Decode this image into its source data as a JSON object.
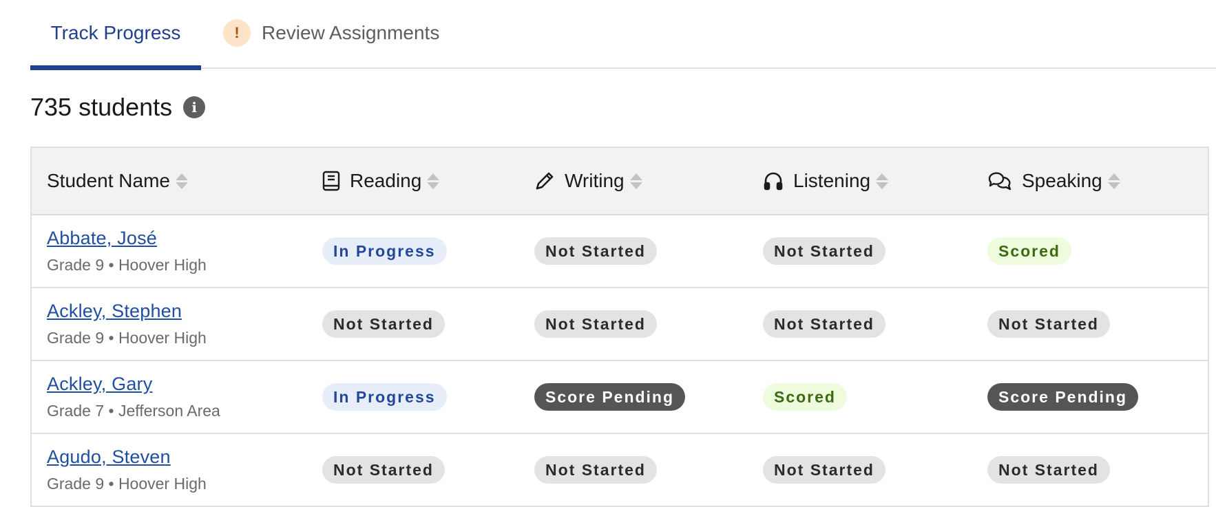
{
  "tabs": [
    {
      "label": "Track Progress",
      "active": true
    },
    {
      "label": "Review Assignments",
      "alert_icon": "exclamation-icon",
      "alert_glyph": "!"
    }
  ],
  "count": {
    "text": "735 students",
    "info_icon": "info-icon",
    "info_glyph": "i"
  },
  "table": {
    "headers": [
      {
        "label": "Student Name"
      },
      {
        "label": "Reading",
        "icon": "book-icon"
      },
      {
        "label": "Writing",
        "icon": "pencil-icon"
      },
      {
        "label": "Listening",
        "icon": "headphones-icon"
      },
      {
        "label": "Speaking",
        "icon": "speech-bubbles-icon"
      }
    ],
    "rows": [
      {
        "name": "Abbate, José",
        "meta": "Grade 9 • Hoover High",
        "statuses": [
          "In Progress",
          "Not Started",
          "Not Started",
          "Scored"
        ]
      },
      {
        "name": "Ackley, Stephen",
        "meta": "Grade 9 • Hoover High",
        "statuses": [
          "Not Started",
          "Not Started",
          "Not Started",
          "Not Started"
        ]
      },
      {
        "name": "Ackley, Gary",
        "meta": "Grade 7 • Jefferson Area",
        "statuses": [
          "In Progress",
          "Score Pending",
          "Scored",
          "Score Pending"
        ]
      },
      {
        "name": "Agudo, Steven",
        "meta": "Grade 9 • Hoover High",
        "statuses": [
          "Not Started",
          "Not Started",
          "Not Started",
          "Not Started"
        ]
      }
    ]
  },
  "colors": {
    "accent": "#1f3f8f",
    "link": "#1f4fa0",
    "in_progress_bg": "#e8eef9",
    "scored_bg": "#eefbdc",
    "pending_bg": "#555555",
    "not_started_bg": "#e3e3e3"
  }
}
